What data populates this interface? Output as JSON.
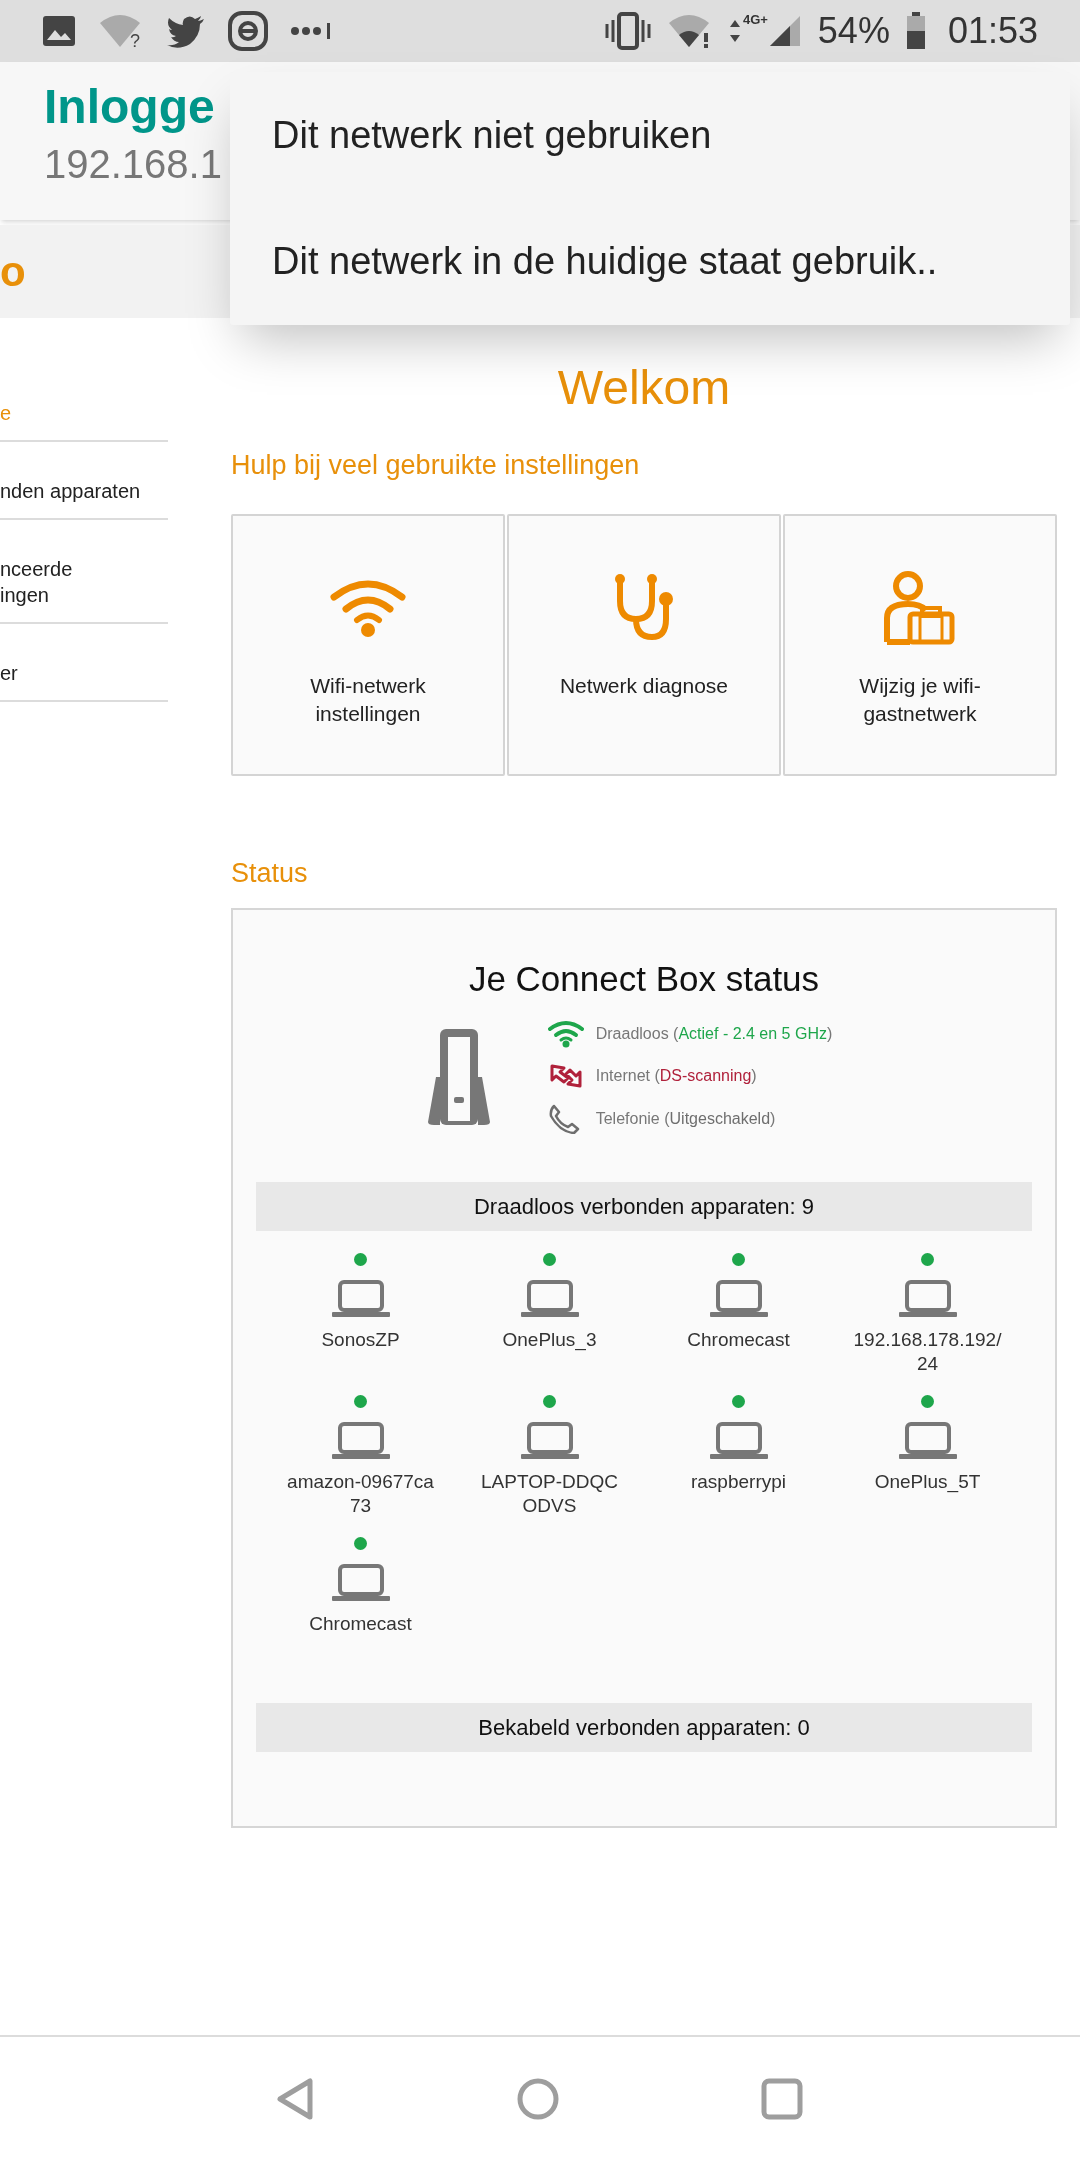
{
  "status_bar": {
    "wifi_mark": "?",
    "network_label": "4G+",
    "battery": "54%",
    "time": "01:53"
  },
  "browser_bar": {
    "title": "Inlogge",
    "address": "192.168.1"
  },
  "overflow_menu": {
    "items": [
      "Dit netwerk niet gebruiken",
      "Dit netwerk in de huidige staat gebruik.."
    ]
  },
  "page_header": {
    "logo_fragment": "o"
  },
  "sidebar": {
    "items": [
      {
        "lines": [
          "e"
        ],
        "selected": true
      },
      {
        "lines": [
          "nden apparaten"
        ],
        "selected": false
      },
      {
        "lines": [
          "nceerde",
          "ingen"
        ],
        "selected": false
      },
      {
        "lines": [
          "er"
        ],
        "selected": false
      }
    ]
  },
  "main": {
    "title": "Welkom",
    "help_heading": "Hulp bij veel gebruikte instellingen",
    "shortcuts": [
      {
        "kind": "wifi",
        "label": "Wifi-netwerk instellingen"
      },
      {
        "kind": "diagnose",
        "label": "Netwerk diagnose"
      },
      {
        "kind": "guest",
        "label": "Wijzig je wifi-gastnetwerk"
      }
    ],
    "status_heading": "Status",
    "status_panel": {
      "title": "Je Connect Box status",
      "services": [
        {
          "kind": "wireless",
          "label": "Draadloos (",
          "state": "Actief - 2.4 en 5 GHz",
          "suffix": ")",
          "color": "#1ea64b"
        },
        {
          "kind": "internet",
          "label": "Internet (",
          "state": "DS-scanning",
          "suffix": ")",
          "color": "#b0213b"
        },
        {
          "kind": "phone",
          "label": "Telefonie (",
          "state": "Uitgeschakeld",
          "suffix": ")",
          "color": "#6e6e6e"
        }
      ],
      "wireless_heading": "Draadloos verbonden apparaten: 9",
      "devices": [
        {
          "name": "SonosZP",
          "online": true
        },
        {
          "name": "OnePlus_3",
          "online": true
        },
        {
          "name": "Chromecast",
          "online": true
        },
        {
          "name": "192.168.178.192/24",
          "online": true
        },
        {
          "name": "amazon-09677ca73",
          "online": true
        },
        {
          "name": "LAPTOP-DDQCODVS",
          "online": true
        },
        {
          "name": "raspberrypi",
          "online": true
        },
        {
          "name": "OnePlus_5T",
          "online": true
        },
        {
          "name": "Chromecast",
          "online": true
        }
      ],
      "wired_heading": "Bekabeld verbonden apparaten: 0"
    }
  }
}
